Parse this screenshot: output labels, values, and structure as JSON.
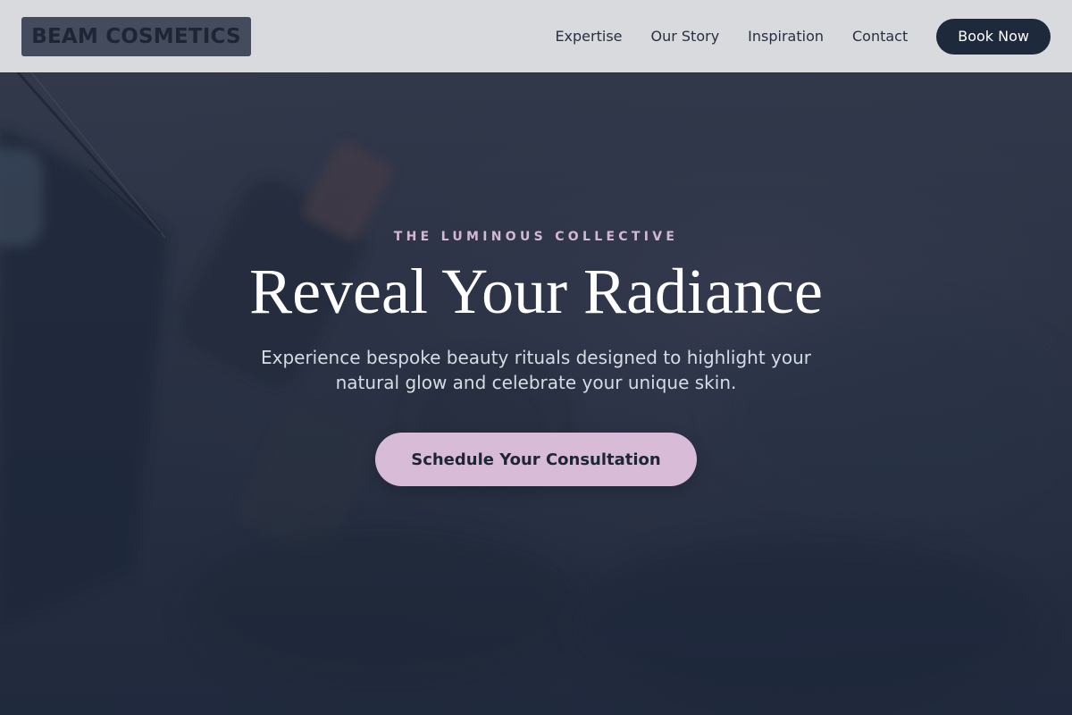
{
  "header": {
    "logo_text": "BEAM COSMETICS",
    "nav": [
      {
        "label": "Expertise"
      },
      {
        "label": "Our Story"
      },
      {
        "label": "Inspiration"
      },
      {
        "label": "Contact"
      }
    ],
    "book_label": "Book Now"
  },
  "hero": {
    "eyebrow": "THE LUMINOUS COLLECTIVE",
    "title": "Reveal Your Radiance",
    "subtitle": "Experience bespoke beauty rituals designed to highlight your natural glow and celebrate your unique skin.",
    "cta_label": "Schedule Your Consultation"
  },
  "colors": {
    "header_bg": "#d9dadd",
    "logo_bg": "#434b5c",
    "primary_dark": "#1e293b",
    "accent_pink": "#d8bcd7",
    "hero_bg": "#2c3345"
  }
}
